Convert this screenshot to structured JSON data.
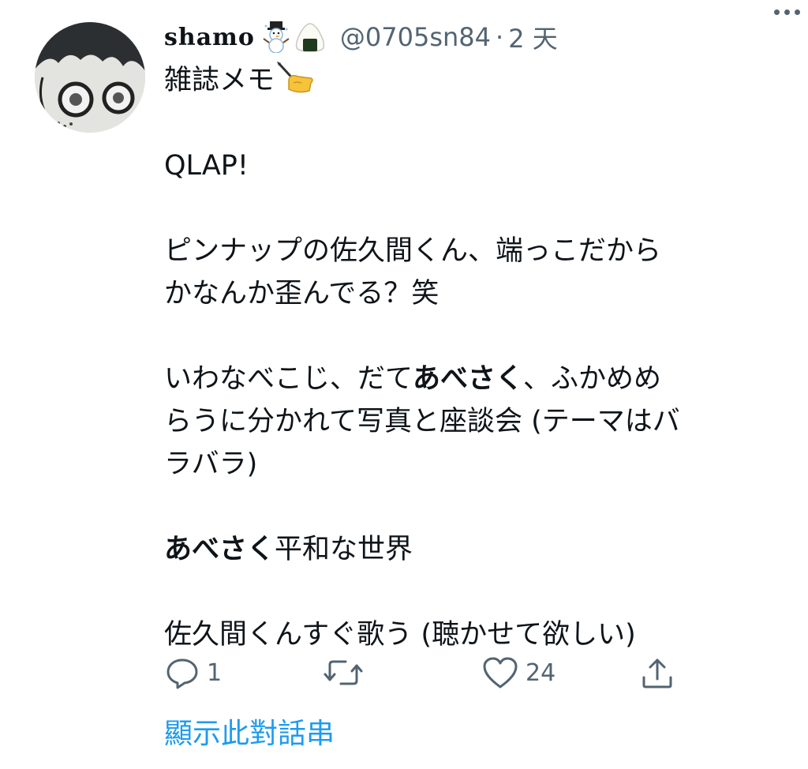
{
  "author": {
    "display_name": "shamo",
    "name_emojis": [
      "snowman-icon",
      "rice-ball-icon"
    ],
    "handle": "@0705sn84",
    "separator": "·",
    "time": "2 天"
  },
  "tweet": {
    "line1_text": "雑誌メモ",
    "line1_emoji": "writing-hand-icon",
    "line2": "QLAP!",
    "para3_line1": "ピンナップの佐久間くん、端っこだから",
    "para3_line2": "かなんか歪んでる？笑",
    "para4_line1_a": "いわなべこじ、だて",
    "para4_line1_bold": "あべさく",
    "para4_line1_b": "、ふかめめ",
    "para4_line2": "らうに分かれて写真と座談会 (テーマはバ",
    "para4_line3": "ラバラ)",
    "para5_bold": "あべさく",
    "para5_rest": "平和な世界",
    "para6": "佐久間くんすぐ歌う (聴かせて欲しい)"
  },
  "actions": {
    "reply_count": "1",
    "retweet_count": "",
    "like_count": "24",
    "share_count": ""
  },
  "thread_link": "顯示此對話串",
  "colors": {
    "text": "#0f1419",
    "secondary": "#536471",
    "link": "#1d9bf0"
  }
}
